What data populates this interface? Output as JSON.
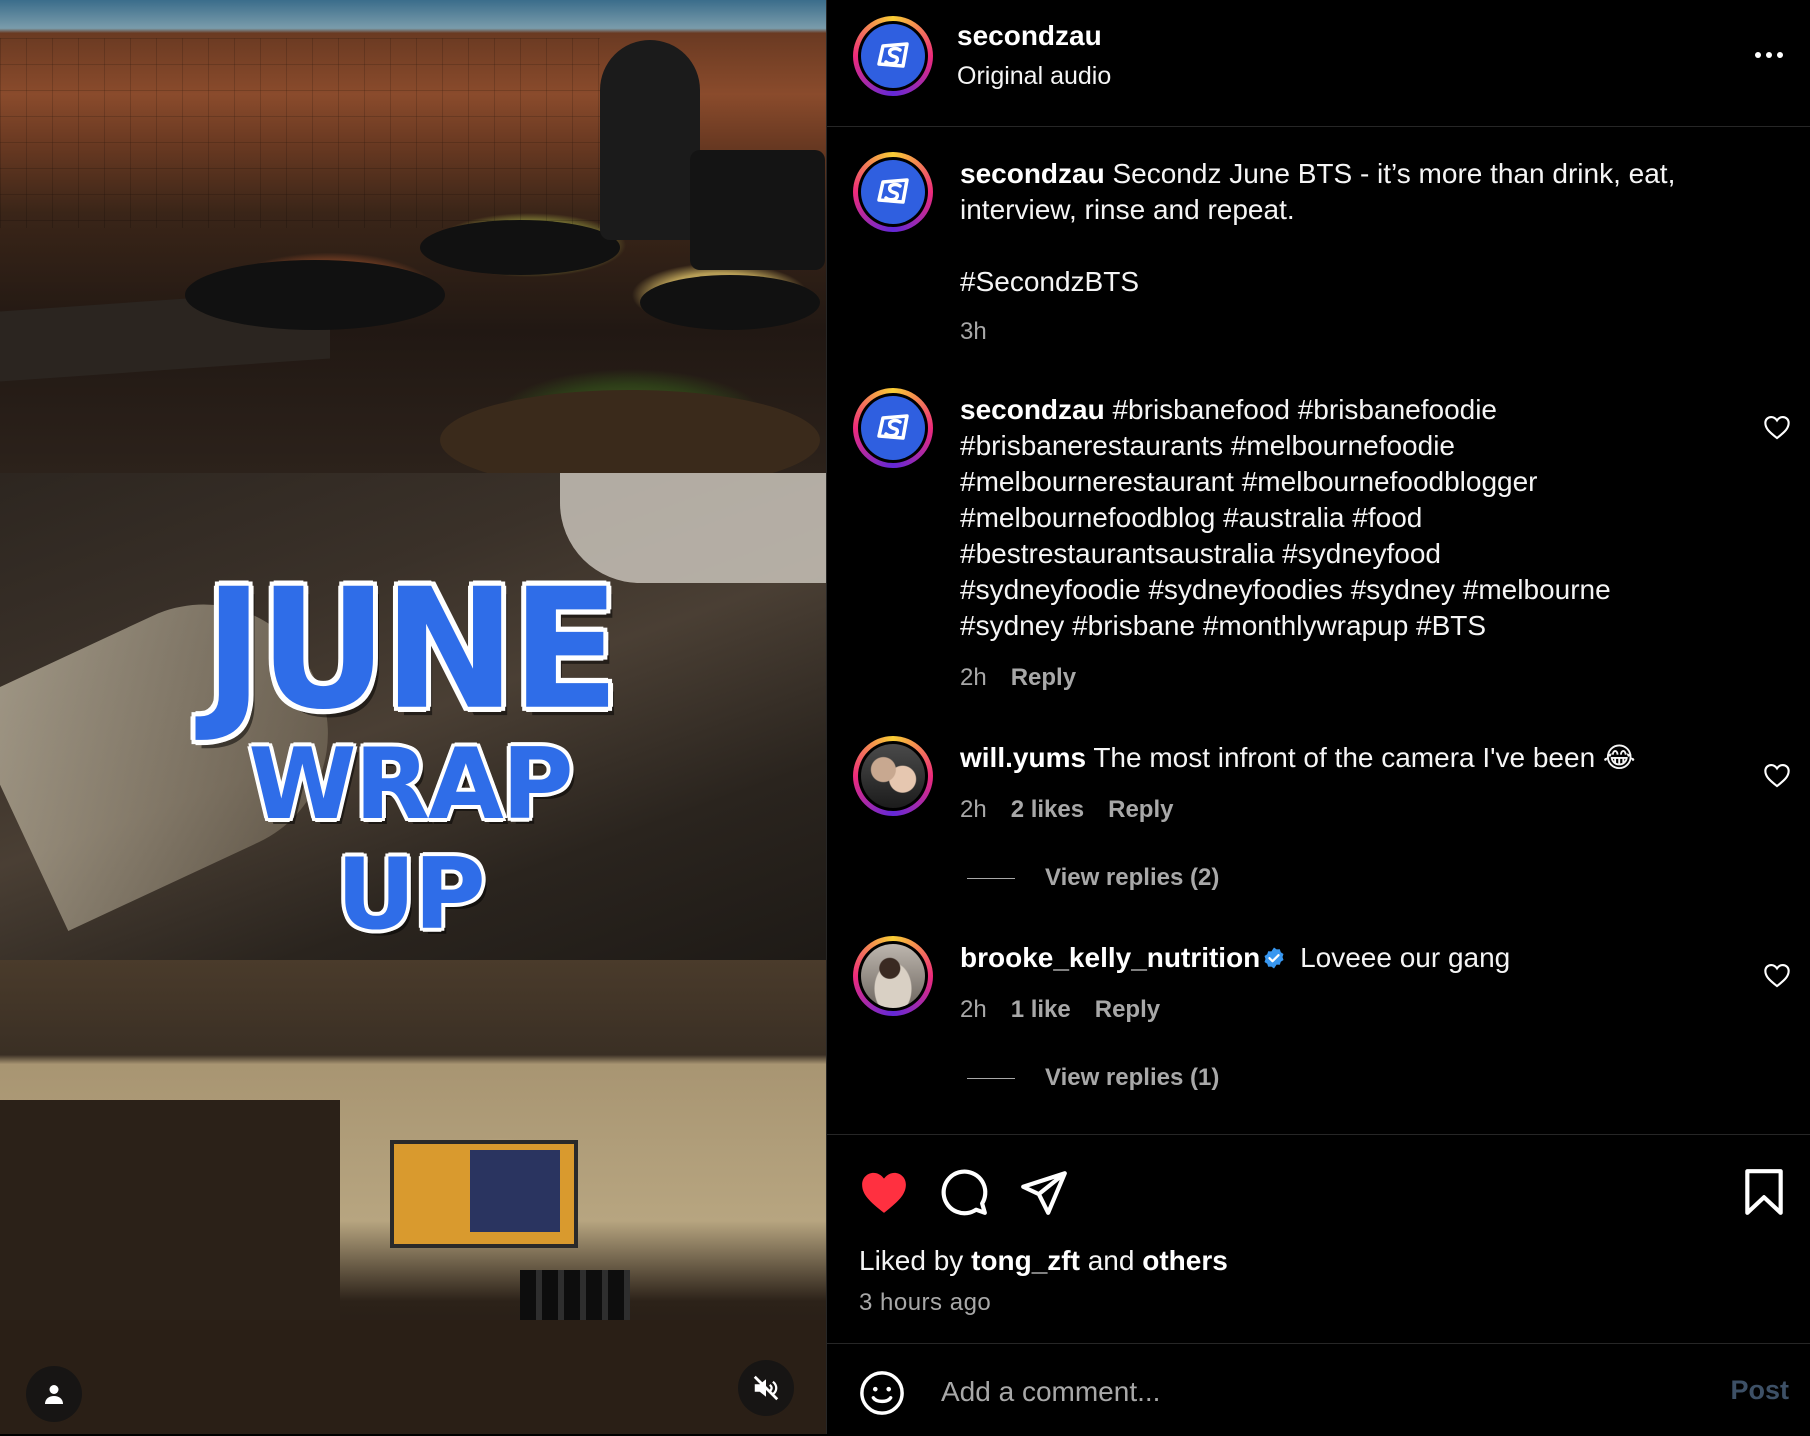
{
  "media": {
    "overlay_line1": "JUNE",
    "overlay_line2": "WRAP UP",
    "tags_icon": "person-icon",
    "mute_icon": "speaker-muted-icon"
  },
  "header": {
    "username": "secondzau",
    "audio": "Original audio",
    "more_icon": "more-horizontal-icon"
  },
  "comments": [
    {
      "username": "secondzau",
      "text": " Secondz June BTS - it’s more than drink, eat, interview, rinse and repeat.",
      "hashtag": "#SecondzBTS",
      "time": "3h"
    },
    {
      "username": "secondzau",
      "text": " #brisbanefood #brisbanefoodie #brisbanerestaurants #melbournefoodie #melbournerestaurant #melbournefoodblogger #melbournefoodblog #australia #food #bestrestaurantsaustralia #sydneyfood #sydneyfoodie #sydneyfoodies #sydney #melbourne #sydney #brisbane #monthlywrapup #BTS",
      "time": "2h",
      "reply": "Reply"
    },
    {
      "username": "will.yums",
      "text": " The most infront of the camera I've been 😂",
      "time": "2h",
      "likes": "2 likes",
      "reply": "Reply",
      "view_replies": "View replies (2)"
    },
    {
      "username": "brooke_kelly_nutrition",
      "text": " Loveee our gang",
      "time": "2h",
      "likes": "1 like",
      "reply": "Reply",
      "view_replies": "View replies (1)"
    }
  ],
  "actions": {
    "like_icon": "heart-filled-icon",
    "comment_icon": "comment-icon",
    "share_icon": "send-icon",
    "save_icon": "bookmark-icon",
    "liked_by_prefix": "Liked by ",
    "liked_by_user": "tong_zft",
    "liked_by_and": " and ",
    "liked_by_others": "others",
    "time_ago": "3 hours ago"
  },
  "comment_bar": {
    "emoji_icon": "emoji-icon",
    "placeholder": "Add a comment...",
    "post_label": "Post"
  },
  "colors": {
    "like_red": "#ff3040",
    "brand_blue": "#2f6de8",
    "muted_text": "#a8a8a8",
    "verified_blue": "#3897f0"
  }
}
